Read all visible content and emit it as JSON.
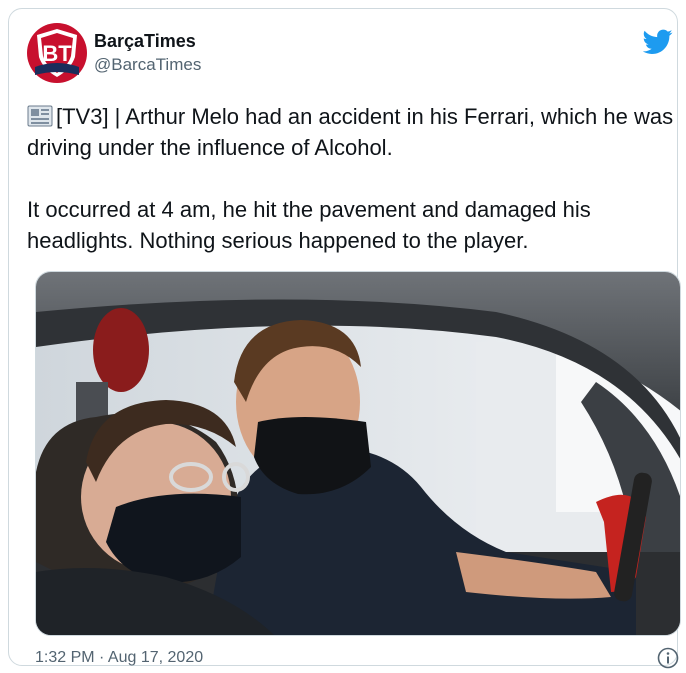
{
  "account": {
    "display_name": "BarçaTimes",
    "handle": "@BarcaTimes"
  },
  "tweet": {
    "paragraph_1": "[TV3] | Arthur Melo had an accident in his Ferrari, which he was driving under the influence of Alcohol.",
    "paragraph_2": "It occurred at 4 am, he hit the pavement and damaged his headlights. Nothing serious happened to the player.",
    "lead_emoji": "newspaper-icon"
  },
  "media": {
    "image_description": "photo-two-masked-men-in-car"
  },
  "footer": {
    "timestamp": "1:32 PM · Aug 17, 2020"
  },
  "colors": {
    "twitter_blue": "#1d9bf0",
    "brand_red": "#c8102e",
    "brand_navy": "#1b2d5b"
  },
  "icons": {
    "platform": "twitter-bird-icon",
    "info": "info-icon"
  }
}
